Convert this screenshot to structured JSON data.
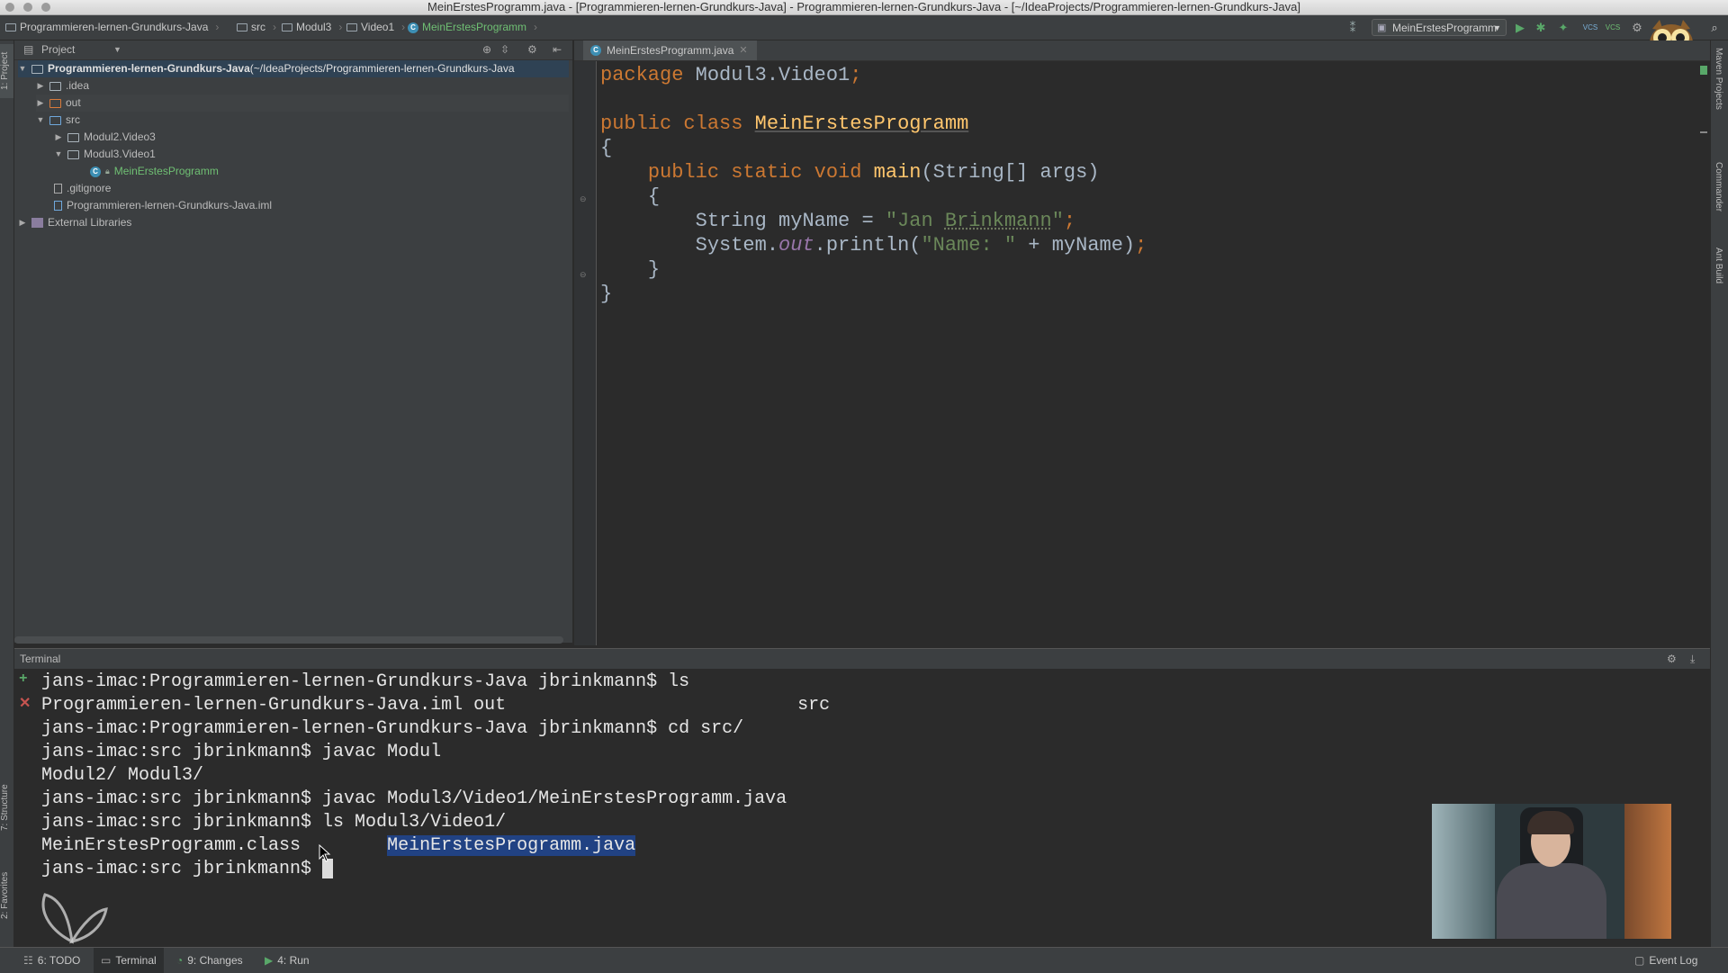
{
  "window": {
    "title": "MeinErstesProgramm.java - [Programmieren-lernen-Grundkurs-Java] - Programmieren-lernen-Grundkurs-Java - [~/IdeaProjects/Programmieren-lernen-Grundkurs-Java]"
  },
  "breadcrumbs": [
    {
      "label": "Programmieren-lernen-Grundkurs-Java",
      "icon": "folder-icon"
    },
    {
      "label": "src",
      "icon": "folder-icon"
    },
    {
      "label": "Modul3",
      "icon": "folder-icon"
    },
    {
      "label": "Video1",
      "icon": "folder-icon"
    },
    {
      "label": "MeinErstesProgramm",
      "icon": "class-icon"
    }
  ],
  "toolbar": {
    "run_config": "MeinErstesProgramm",
    "run_color": "#59a869",
    "vcs_label": "VCS"
  },
  "project_panel": {
    "header": "Project",
    "tree": [
      {
        "label": "Programmieren-lernen-Grundkurs-Java",
        "suffix": " (~/IdeaProjects/Programmieren-lernen-Grundkurs-Java",
        "depth": 0,
        "expanded": true,
        "bold": true
      },
      {
        "label": ".idea",
        "depth": 1,
        "expanded": false
      },
      {
        "label": "out",
        "depth": 1,
        "expanded": false,
        "color": "#d97b3b"
      },
      {
        "label": "src",
        "depth": 1,
        "expanded": true
      },
      {
        "label": "Modul2.Video3",
        "depth": 2,
        "expanded": false
      },
      {
        "label": "Modul3.Video1",
        "depth": 2,
        "expanded": true
      },
      {
        "label": "MeinErstesProgramm",
        "depth": 3,
        "color": "#6fa8dc"
      },
      {
        "label": ".gitignore",
        "depth": 1
      },
      {
        "label": "Programmieren-lernen-Grundkurs-Java.iml",
        "depth": 1
      },
      {
        "label": "External Libraries",
        "depth": 0,
        "expanded": false
      }
    ]
  },
  "editor": {
    "tab_label": "MeinErstesProgramm.java",
    "lines": {
      "l1_kw": "package ",
      "l1_rest": "Modul3.Video1",
      "l1_semi": ";",
      "l3_kw": "public class ",
      "l3_cls": "MeinErstesProgramm",
      "l4": "{",
      "l5_kw": "public static void ",
      "l5_fn": "main",
      "l5_rest": "(String[] args)",
      "l6": "{",
      "l7_a": "String myName = ",
      "l7_str_a": "\"Jan ",
      "l7_str_b": "Brinkmann",
      "l7_str_c": "\"",
      "l7_semi": ";",
      "l8_a": "System.",
      "l8_fld": "out",
      "l8_b": ".println(",
      "l8_str": "\"Name: \"",
      "l8_c": " + myName)",
      "l8_semi": ";",
      "l9": "}",
      "l10": "}"
    }
  },
  "terminal": {
    "header": "Terminal",
    "lines": [
      "jans-imac:Programmieren-lernen-Grundkurs-Java jbrinkmann$ ls",
      "Programmieren-lernen-Grundkurs-Java.iml out                           src",
      "jans-imac:Programmieren-lernen-Grundkurs-Java jbrinkmann$ cd src/",
      "jans-imac:src jbrinkmann$ javac Modul",
      "Modul2/ Modul3/",
      "jans-imac:src jbrinkmann$ javac Modul3/Video1/MeinErstesProgramm.java",
      "jans-imac:src jbrinkmann$ ls Modul3/Video1/"
    ],
    "ls_result_a": "MeinErstesProgramm.class",
    "ls_result_b": "MeinErstesProgramm.java",
    "prompt": "jans-imac:src jbrinkmann$ "
  },
  "left_strip": {
    "project_tab": "1: Project",
    "structure_tab": "7: Structure",
    "favorites_tab": "2: Favorites"
  },
  "right_strip": {
    "maven_tab": "Maven Projects",
    "commander_tab": "Commander",
    "ant_tab": "Ant Build"
  },
  "statusbar": {
    "todo": "6: TODO",
    "terminal": "Terminal",
    "changes": "9: Changes",
    "run": "4: Run",
    "event_log": "Event Log"
  }
}
